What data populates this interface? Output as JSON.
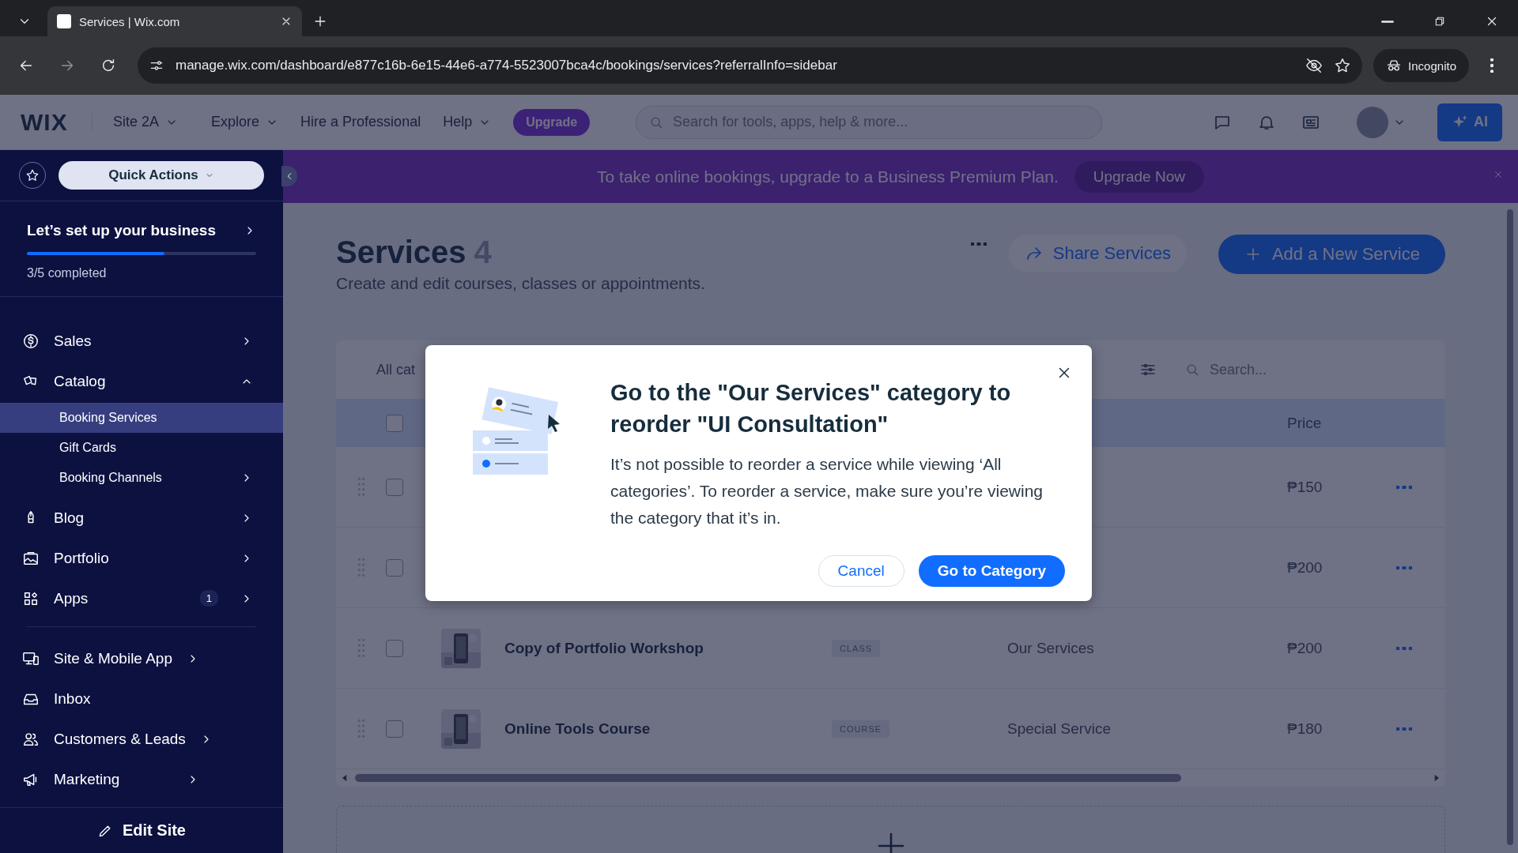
{
  "browser": {
    "tab_title": "Services | Wix.com",
    "url": "manage.wix.com/dashboard/e877c16b-6e15-44e6-a774-5523007bca4c/bookings/services?referralInfo=sidebar",
    "profile": "Incognito"
  },
  "header": {
    "logo": "WIX",
    "site": "Site 2A",
    "nav": [
      {
        "label": "Explore",
        "caret": true
      },
      {
        "label": "Hire a Professional",
        "caret": false
      },
      {
        "label": "Help",
        "caret": true
      }
    ],
    "upgrade": "Upgrade",
    "search_placeholder": "Search for tools, apps, help & more...",
    "ai": "AI"
  },
  "banner": {
    "message": "To take online bookings, upgrade to a Business Premium Plan.",
    "button": "Upgrade Now"
  },
  "sidebar": {
    "quick_actions": "Quick Actions",
    "setup": {
      "title": "Let’s set up your business",
      "level": 0.6,
      "status": "3/5 completed"
    },
    "groups": [
      [
        {
          "label": "Sales",
          "arrow": true,
          "expanded": false,
          "selected": false
        },
        {
          "label": "Catalog",
          "expanded": true,
          "selected": false,
          "children": [
            {
              "label": "Booking Services",
              "selected": true,
              "arrow": false
            },
            {
              "label": "Gift Cards",
              "selected": false,
              "arrow": false
            },
            {
              "label": "Booking Channels",
              "selected": false,
              "arrow": true
            }
          ]
        },
        {
          "label": "Blog",
          "arrow": true,
          "expanded": false,
          "selected": false
        },
        {
          "label": "Portfolio",
          "arrow": true,
          "expanded": false,
          "selected": false
        },
        {
          "label": "Apps",
          "arrow": true,
          "expanded": false,
          "selected": false,
          "badge": "1"
        }
      ],
      [
        {
          "label": "Site & Mobile App",
          "arrow": true,
          "expanded": false,
          "selected": false
        },
        {
          "label": "Inbox",
          "arrow": false,
          "expanded": false,
          "selected": false
        },
        {
          "label": "Customers & Leads",
          "arrow": true,
          "expanded": false,
          "selected": false
        },
        {
          "label": "Marketing",
          "arrow": true,
          "expanded": false,
          "selected": false
        }
      ]
    ],
    "edit_site": "Edit Site"
  },
  "page": {
    "title": "Services",
    "count": "4",
    "subtitle": "Create and edit courses, classes or appointments.",
    "share": "Share Services",
    "add": "Add a New Service"
  },
  "table": {
    "filter": "All cat",
    "search_placeholder": "Search...",
    "select_all": false,
    "columns": [
      {
        "label": "Price"
      }
    ],
    "rows": [
      {
        "checked": false,
        "price": "₱150"
      },
      {
        "checked": false,
        "price": "₱200"
      },
      {
        "checked": false,
        "name": "Copy of Portfolio Workshop",
        "type": "CLASS",
        "category": "Our Services",
        "price": "₱200"
      },
      {
        "checked": false,
        "name": "Online Tools Course",
        "type": "COURSE",
        "category": "Special Service",
        "price": "₱180"
      }
    ]
  },
  "dialog": {
    "title": "Go to the \"Our Services\" category to reorder \"UI Consultation\"",
    "body": "It’s not possible to reorder a service while viewing ‘All categories’. To reorder a service, make sure you’re viewing the category that it’s in.",
    "cancel": "Cancel",
    "confirm": "Go to Category"
  }
}
